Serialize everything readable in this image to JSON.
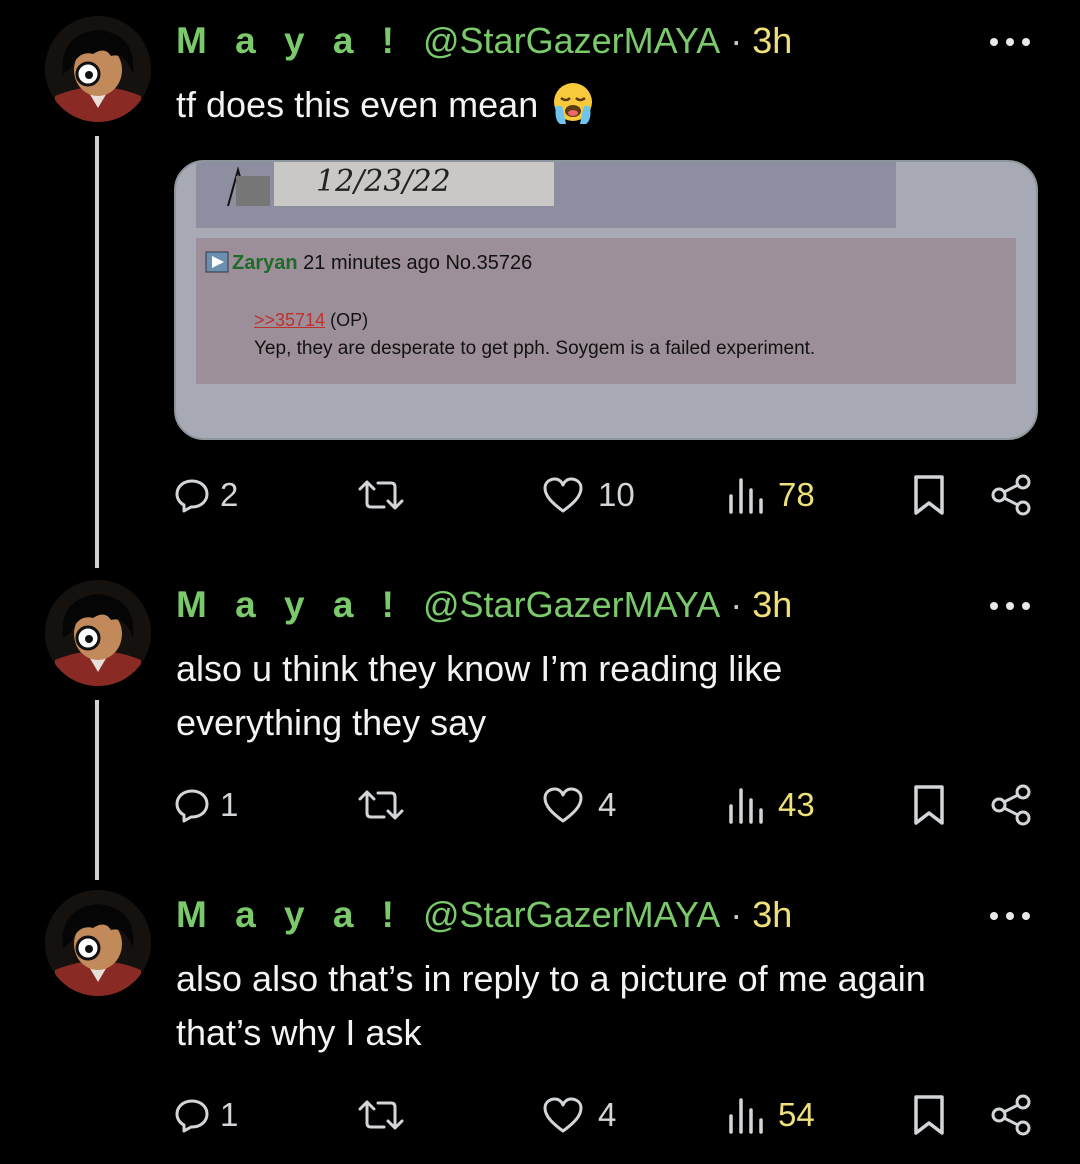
{
  "tweets": [
    {
      "name": "M a y a !",
      "handle": "@StarGazerMAYA",
      "separator": "·",
      "time": "3h",
      "text": "tf does this even mean",
      "emoji": "loudly-crying-face-emoji",
      "replies": "2",
      "likes": "10",
      "views": "78",
      "embed": {
        "date_text": "12/23/22",
        "post_name": "Zaryan",
        "post_meta": "21 minutes ago No.35726",
        "reply_link": ">>35714",
        "op_tag": "(OP)",
        "post_body": "Yep, they are desperate to get pph. Soygem is a failed experiment."
      }
    },
    {
      "name": "M a y a !",
      "handle": "@StarGazerMAYA",
      "separator": "·",
      "time": "3h",
      "text_line1": "also u think they know I’m reading like",
      "text_line2": "everything they say",
      "replies": "1",
      "likes": "4",
      "views": "43"
    },
    {
      "name": "M a y a !",
      "handle": "@StarGazerMAYA",
      "separator": "·",
      "time": "3h",
      "text_line1": "also also that’s in reply to a picture of me again",
      "text_line2": "that’s why I ask",
      "replies": "1",
      "likes": "4",
      "views": "54"
    }
  ],
  "icons": [
    "reply-icon",
    "retweet-icon",
    "like-icon",
    "views-icon",
    "bookmark-icon",
    "share-icon",
    "more-options-icon"
  ],
  "colors": {
    "background": "#000000",
    "name_green": "#7ac96a",
    "time_yellow": "#f0e07a",
    "icon_gray": "#d3d6d9",
    "embed_bg": "#a5a8b3",
    "embed_post_bg": "#9d8f99"
  }
}
